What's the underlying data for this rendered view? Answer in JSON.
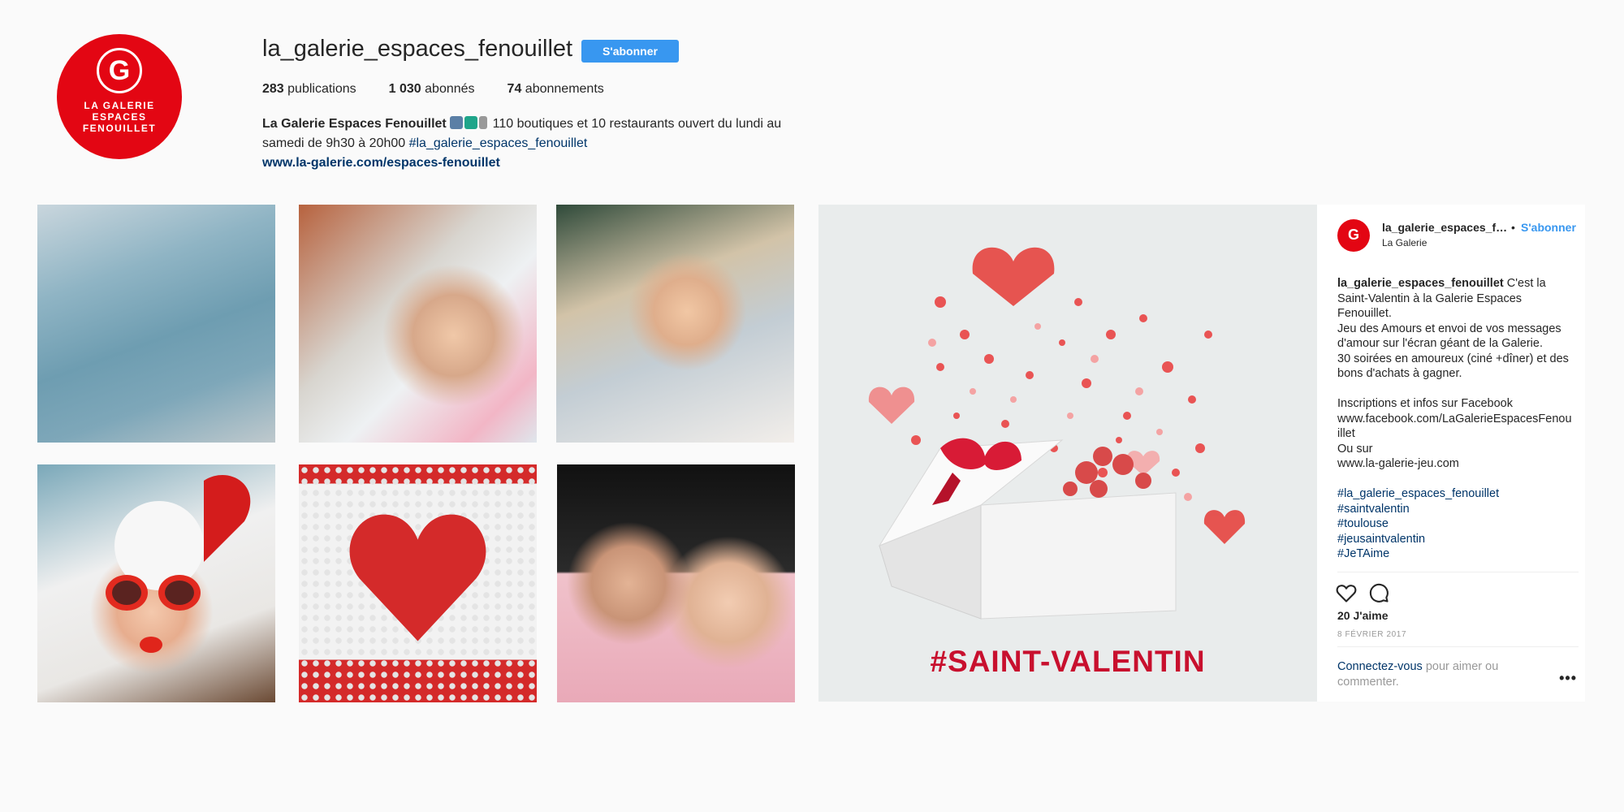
{
  "profile": {
    "avatar_logo": {
      "letter": "G",
      "lines": [
        "LA GALERIE",
        "ESPACES",
        "FENOUILLET"
      ]
    },
    "username": "la_galerie_espaces_fenouillet",
    "follow_label": "S'abonner",
    "stats": {
      "posts_count": "283",
      "posts_label": "publications",
      "followers_count": "1 030",
      "followers_label": "abonnés",
      "following_count": "74",
      "following_label": "abonnements"
    },
    "bio": {
      "name": "La Galerie Espaces Fenouillet",
      "text": "110 boutiques et 10 restaurants ouvert du lundi au samedi de 9h30 à 20h00",
      "hashtag": "#la_galerie_espaces_fenouillet",
      "website": "www.la-galerie.com/espaces-fenouillet"
    }
  },
  "grid": {
    "posts": [
      {
        "subject": "knitted-mittens"
      },
      {
        "subject": "couple-in-snow"
      },
      {
        "subject": "couple-winter-hats"
      },
      {
        "subject": "woman-heart-sunglasses"
      },
      {
        "subject": "knitted-heart-pattern"
      },
      {
        "subject": "couple-portrait"
      }
    ]
  },
  "post": {
    "image_hashtag": "#SAINT-VALENTIN",
    "username": "la_galerie_espaces_fenouillet",
    "follow_label": "S'abonner",
    "location": "La Galerie",
    "caption": {
      "user": "la_galerie_espaces_fenouillet",
      "intro": "C'est la Saint-Valentin à la Galerie Espaces Fenouillet.",
      "line2": "Jeu des Amours et envoi de vos messages d'amour sur l'écran géant de la Galerie.",
      "line3": "30 soirées en amoureux (ciné +dîner) et des bons d'achats à gagner.",
      "line4": "Inscriptions et infos sur Facebook",
      "line5": "www.facebook.com/LaGalerieEspacesFenouillet",
      "line6": "Ou sur",
      "line7": "www.la-galerie-jeu.com",
      "hashtags": [
        "#la_galerie_espaces_fenouillet",
        "#saintvalentin",
        "#toulouse",
        "#jeusaintvalentin",
        "#JeTAime"
      ]
    },
    "likes": "20 J'aime",
    "date": "8 FÉVRIER 2017",
    "login_link": "Connectez-vous",
    "login_text": "pour aimer ou commenter.",
    "more_label": "•••"
  },
  "colors": {
    "brand_red": "#e30613",
    "follow_blue": "#3897f0",
    "link_navy": "#003569",
    "hashtag_red": "#c8102e"
  },
  "icons": [
    "heart-icon",
    "comment-icon",
    "more-options-icon"
  ]
}
